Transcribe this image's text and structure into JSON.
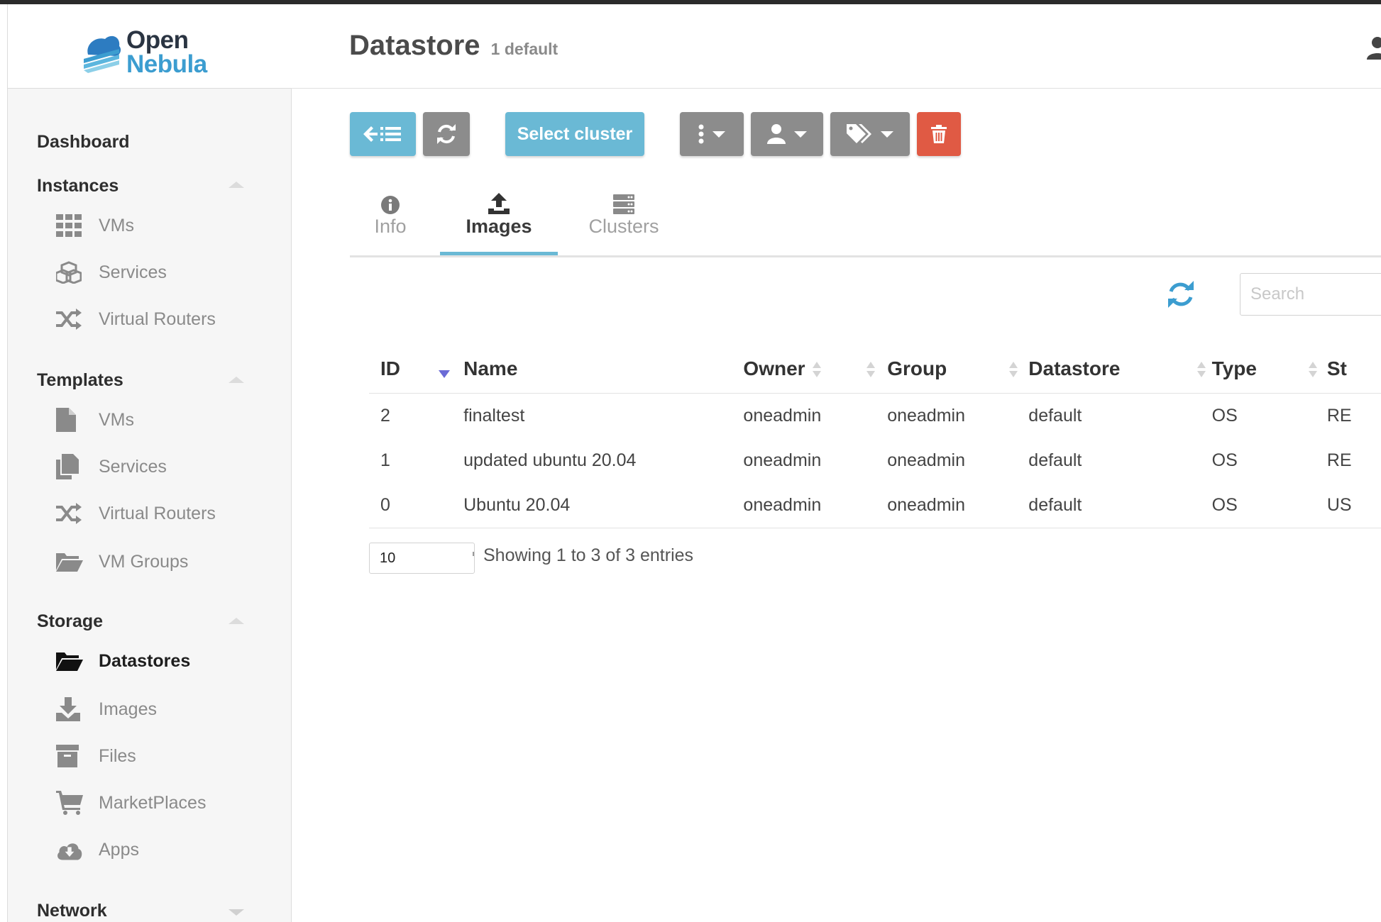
{
  "app": {
    "logo_line1": "Open",
    "logo_line2": "Nebula"
  },
  "sidebar": {
    "dashboard": "Dashboard",
    "instances": {
      "title": "Instances",
      "items": [
        {
          "label": "VMs",
          "icon": "grid-icon"
        },
        {
          "label": "Services",
          "icon": "cubes-icon"
        },
        {
          "label": "Virtual Routers",
          "icon": "random-icon"
        }
      ]
    },
    "templates": {
      "title": "Templates",
      "items": [
        {
          "label": "VMs",
          "icon": "file-icon"
        },
        {
          "label": "Services",
          "icon": "files-icon"
        },
        {
          "label": "Virtual Routers",
          "icon": "random-icon"
        },
        {
          "label": "VM Groups",
          "icon": "folder-open-icon"
        }
      ]
    },
    "storage": {
      "title": "Storage",
      "items": [
        {
          "label": "Datastores",
          "icon": "folder-open-icon",
          "active": true
        },
        {
          "label": "Images",
          "icon": "download-icon"
        },
        {
          "label": "Files",
          "icon": "archive-icon"
        },
        {
          "label": "MarketPlaces",
          "icon": "cart-icon"
        },
        {
          "label": "Apps",
          "icon": "cloud-download-icon"
        }
      ]
    },
    "network": {
      "title": "Network"
    }
  },
  "header": {
    "title": "Datastore",
    "subtitle": "1 default"
  },
  "toolbar": {
    "back_icon": "back-list-icon",
    "refresh_icon": "refresh-icon",
    "select_cluster": "Select cluster",
    "more_icon": "ellipsis-v-icon",
    "owner_icon": "user-icon",
    "labels_icon": "tags-icon",
    "delete_icon": "trash-icon"
  },
  "colors": {
    "primary": "#6ab9d5",
    "secondary": "#8c8c8c",
    "danger": "#e05a44",
    "sort_active": "#6b6bd6",
    "refresh": "#3c9dd0"
  },
  "tabs": [
    {
      "label": "Info",
      "icon": "info-circle-icon"
    },
    {
      "label": "Images",
      "icon": "upload-icon",
      "active": true
    },
    {
      "label": "Clusters",
      "icon": "server-icon"
    }
  ],
  "table": {
    "search_placeholder": "Search",
    "columns": [
      "ID",
      "Name",
      "Owner",
      "Group",
      "Datastore",
      "Type",
      "St"
    ],
    "rows": [
      [
        "2",
        "finaltest",
        "oneadmin",
        "oneadmin",
        "default",
        "OS",
        "RE"
      ],
      [
        "1",
        "updated ubuntu 20.04",
        "oneadmin",
        "oneadmin",
        "default",
        "OS",
        "RE"
      ],
      [
        "0",
        "Ubuntu 20.04",
        "oneadmin",
        "oneadmin",
        "default",
        "OS",
        "US"
      ]
    ],
    "page_length": "10",
    "info": "Showing 1 to 3 of 3 entries"
  }
}
